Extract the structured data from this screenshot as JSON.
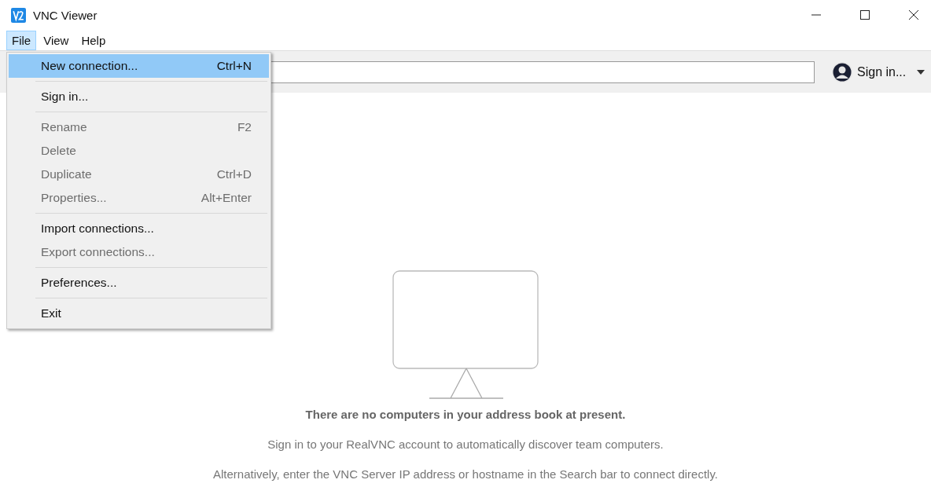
{
  "window": {
    "title": "VNC Viewer"
  },
  "menubar": [
    {
      "label": "File",
      "selected": true
    },
    {
      "label": "View",
      "selected": false
    },
    {
      "label": "Help",
      "selected": false
    }
  ],
  "file_menu": [
    {
      "kind": "item",
      "label": "New connection...",
      "shortcut": "Ctrl+N",
      "selected": true,
      "disabled": false
    },
    {
      "kind": "separator"
    },
    {
      "kind": "item",
      "label": "Sign in...",
      "selected": false,
      "disabled": false
    },
    {
      "kind": "separator"
    },
    {
      "kind": "item",
      "label": "Rename",
      "shortcut": "F2",
      "selected": false,
      "disabled": true
    },
    {
      "kind": "item",
      "label": "Delete",
      "selected": false,
      "disabled": true
    },
    {
      "kind": "item",
      "label": "Duplicate",
      "shortcut": "Ctrl+D",
      "selected": false,
      "disabled": true
    },
    {
      "kind": "item",
      "label": "Properties...",
      "shortcut": "Alt+Enter",
      "selected": false,
      "disabled": true
    },
    {
      "kind": "separator"
    },
    {
      "kind": "item",
      "label": "Import connections...",
      "selected": false,
      "disabled": false
    },
    {
      "kind": "item",
      "label": "Export connections...",
      "selected": false,
      "disabled": true
    },
    {
      "kind": "separator"
    },
    {
      "kind": "item",
      "label": "Preferences...",
      "selected": false,
      "disabled": false
    },
    {
      "kind": "separator"
    },
    {
      "kind": "item",
      "label": "Exit",
      "selected": false,
      "disabled": false
    }
  ],
  "toolbar": {
    "sign_in": "Sign in..."
  },
  "empty_state": {
    "heading": "There are no computers in your address book at present.",
    "lines": [
      "Sign in to your RealVNC account to automatically discover team computers.",
      "Alternatively, enter the VNC Server IP address or hostname in the Search bar to connect directly."
    ]
  }
}
